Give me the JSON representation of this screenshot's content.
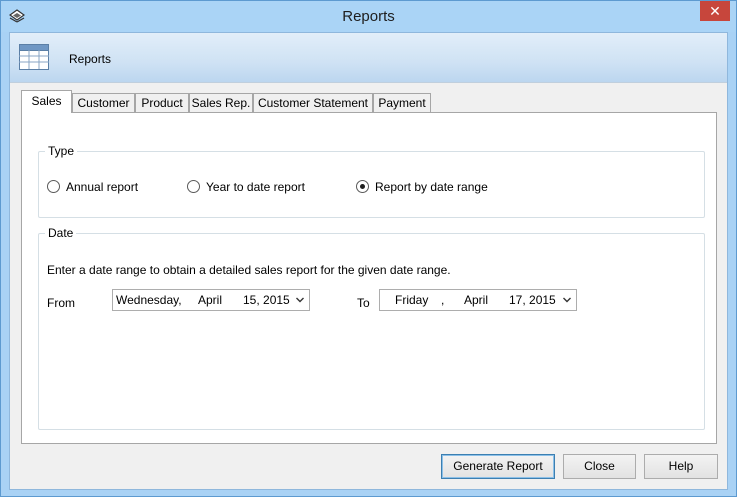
{
  "window": {
    "title": "Reports",
    "close_glyph": "✕"
  },
  "header": {
    "title": "Reports"
  },
  "tabs": [
    {
      "label": "Sales",
      "active": true
    },
    {
      "label": "Customer"
    },
    {
      "label": "Product"
    },
    {
      "label": "Sales Rep."
    },
    {
      "label": "Customer Statement"
    },
    {
      "label": "Payment"
    }
  ],
  "type_group": {
    "legend": "Type",
    "options": [
      {
        "label": "Annual report",
        "checked": false
      },
      {
        "label": "Year to date report",
        "checked": false
      },
      {
        "label": "Report by date range",
        "checked": true
      }
    ]
  },
  "date_group": {
    "legend": "Date",
    "instruction": "Enter a date range to obtain a detailed sales report for the given date range.",
    "from_label": "From",
    "to_label": "To",
    "from": {
      "weekday": "Wednesday,",
      "month": "April",
      "day_year": "15, 2015"
    },
    "to": {
      "weekday": "Friday",
      "sep": ",",
      "month": "April",
      "day_year": "17, 2015"
    }
  },
  "buttons": {
    "generate": "Generate Report",
    "close": "Close",
    "help": "Help"
  },
  "colors": {
    "titlebar": "#aad4f6",
    "close_button": "#c7463c",
    "panel": "#ffffff",
    "default_button_border": "#3c7fb1"
  },
  "icons": {
    "app": "app-logo-icon",
    "header": "table-grid-icon",
    "dropdown": "chevron-down-icon",
    "close": "close-icon"
  }
}
